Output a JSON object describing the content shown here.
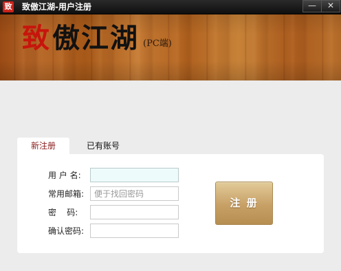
{
  "window": {
    "title": "致傲江湖-用户注册",
    "icon_glyph": "致",
    "minimize_glyph": "—",
    "close_glyph": "✕"
  },
  "banner": {
    "logo_first": "致",
    "logo_rest": "傲江湖",
    "logo_sub": "(PC端)"
  },
  "tabs": [
    {
      "label": "新注册",
      "active": true
    },
    {
      "label": "已有账号",
      "active": false
    }
  ],
  "form": {
    "username": {
      "label": "用 户 名:",
      "value": "",
      "placeholder": ""
    },
    "email": {
      "label": "常用邮箱:",
      "value": "",
      "placeholder": "便于找回密码"
    },
    "password": {
      "label": "密    码:",
      "value": "",
      "placeholder": ""
    },
    "confirm": {
      "label": "确认密码:",
      "value": "",
      "placeholder": ""
    }
  },
  "actions": {
    "register_label": "注 册"
  },
  "colors": {
    "titlebar": "#1a1a1a",
    "logo_accent": "#c7150c",
    "tab_active_text": "#8b1c1c",
    "button_gold": "#c7a066"
  }
}
